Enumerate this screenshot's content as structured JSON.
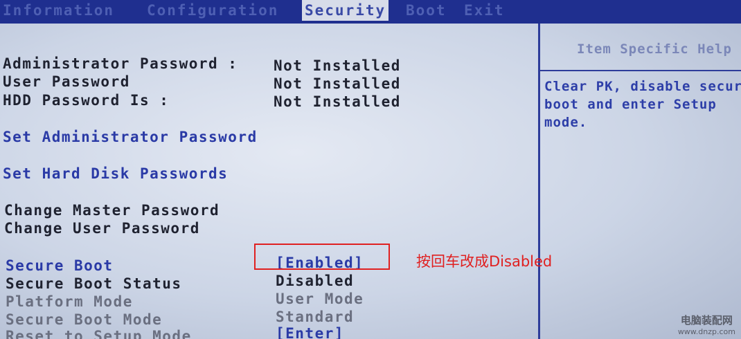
{
  "menu": {
    "tabs": [
      {
        "label": "Information",
        "active": false
      },
      {
        "label": "Configuration",
        "active": false
      },
      {
        "label": "Security",
        "active": true
      },
      {
        "label": "Boot",
        "active": false
      },
      {
        "label": "Exit",
        "active": false
      }
    ]
  },
  "help": {
    "title": "Item Specific Help",
    "text": "Clear PK, disable secure\nboot and enter Setup\nmode."
  },
  "settings": {
    "admin_password": {
      "label": "Administrator Password :",
      "value": "Not Installed"
    },
    "user_password": {
      "label": "User Password",
      "value": "Not Installed"
    },
    "hdd_password": {
      "label": "HDD Password Is :",
      "value": "Not Installed"
    },
    "set_admin_password": {
      "label": "Set Administrator Password"
    },
    "set_hdd_passwords": {
      "label": "Set Hard Disk Passwords"
    },
    "change_master_password": {
      "label": "Change Master Password"
    },
    "change_user_password": {
      "label": "Change User Password"
    },
    "secure_boot": {
      "label": "Secure Boot",
      "value": "[Enabled]"
    },
    "secure_boot_status": {
      "label": "Secure Boot Status",
      "value": "Disabled"
    },
    "platform_mode": {
      "label": "Platform Mode",
      "value": "User Mode"
    },
    "secure_boot_mode": {
      "label": "Secure Boot Mode",
      "value": "Standard"
    },
    "reset_setup_mode": {
      "label": "Reset to Setup Mode",
      "value": "[Enter]"
    }
  },
  "annotation": {
    "text": "按回车改成Disabled",
    "color": "#e02020"
  },
  "watermark": {
    "name": "电脑装配网",
    "url": "www.dnzp.com"
  },
  "colors": {
    "menubar": "#1f2f8f",
    "selectable": "#2a3aa6",
    "static": "#1f2230",
    "disabled": "#6a6f80"
  }
}
